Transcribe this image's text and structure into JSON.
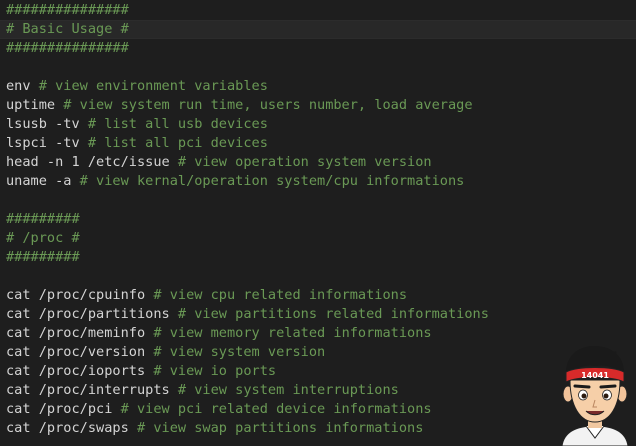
{
  "editor": {
    "lines": [
      {
        "code": "",
        "comment": "###############"
      },
      {
        "code": "",
        "comment": "# Basic Usage #"
      },
      {
        "code": "",
        "comment": "###############"
      },
      {
        "code": "",
        "comment": ""
      },
      {
        "code": "env ",
        "comment": "# view environment variables"
      },
      {
        "code": "uptime ",
        "comment": "# view system run time, users number, load average"
      },
      {
        "code": "lsusb -tv ",
        "comment": "# list all usb devices"
      },
      {
        "code": "lspci -tv ",
        "comment": "# list all pci devices"
      },
      {
        "code": "head -n 1 /etc/issue ",
        "comment": "# view operation system version"
      },
      {
        "code": "uname -a ",
        "comment": "# view kernal/operation system/cpu informations"
      },
      {
        "code": "",
        "comment": ""
      },
      {
        "code": "",
        "comment": "#########"
      },
      {
        "code": "",
        "comment": "# /proc #"
      },
      {
        "code": "",
        "comment": "#########"
      },
      {
        "code": "",
        "comment": ""
      },
      {
        "code": "cat /proc/cpuinfo ",
        "comment": "# view cpu related informations"
      },
      {
        "code": "cat /proc/partitions ",
        "comment": "# view partitions related informations"
      },
      {
        "code": "cat /proc/meminfo ",
        "comment": "# view memory related informations"
      },
      {
        "code": "cat /proc/version ",
        "comment": "# view system version"
      },
      {
        "code": "cat /proc/ioports ",
        "comment": "# view io ports"
      },
      {
        "code": "cat /proc/interrupts ",
        "comment": "# view system interruptions"
      },
      {
        "code": "cat /proc/pci ",
        "comment": "# view pci related device informations"
      },
      {
        "code": "cat /proc/swaps ",
        "comment": "# view swap partitions informations"
      }
    ],
    "current_line": 1
  },
  "avatar": {
    "headband_text": "14041"
  },
  "colors": {
    "background": "#1e1e1e",
    "code": "#d4d4d4",
    "comment": "#6a9955"
  }
}
